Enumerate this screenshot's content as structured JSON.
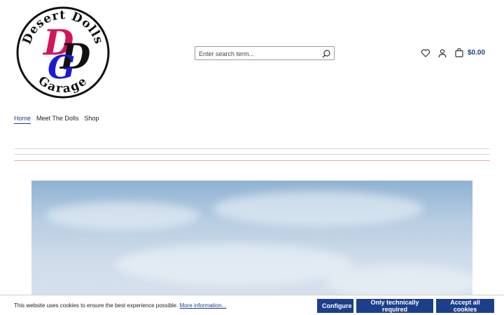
{
  "header": {
    "logo": {
      "text_top": "Desert Dolls",
      "text_bottom": "Garage",
      "letters": [
        "D",
        "D",
        "G"
      ],
      "colors": [
        "#d4145a",
        "#111111",
        "#1a1ad4"
      ]
    },
    "search": {
      "placeholder": "Enter search term..."
    },
    "icons": [
      "heart-icon",
      "user-icon",
      "shopping-bag-icon",
      "search-icon"
    ],
    "cart_total": "$0.00",
    "accent_color": "#1c3f8c"
  },
  "nav": {
    "items": [
      "Home",
      "Meet The Dolls",
      "Shop"
    ],
    "active_index": 0
  },
  "cookie_banner": {
    "text": "This website uses cookies to ensure the best experience possible.",
    "link": "More information...",
    "buttons": [
      "Configure",
      "Only technically required",
      "Accept all cookies"
    ]
  }
}
